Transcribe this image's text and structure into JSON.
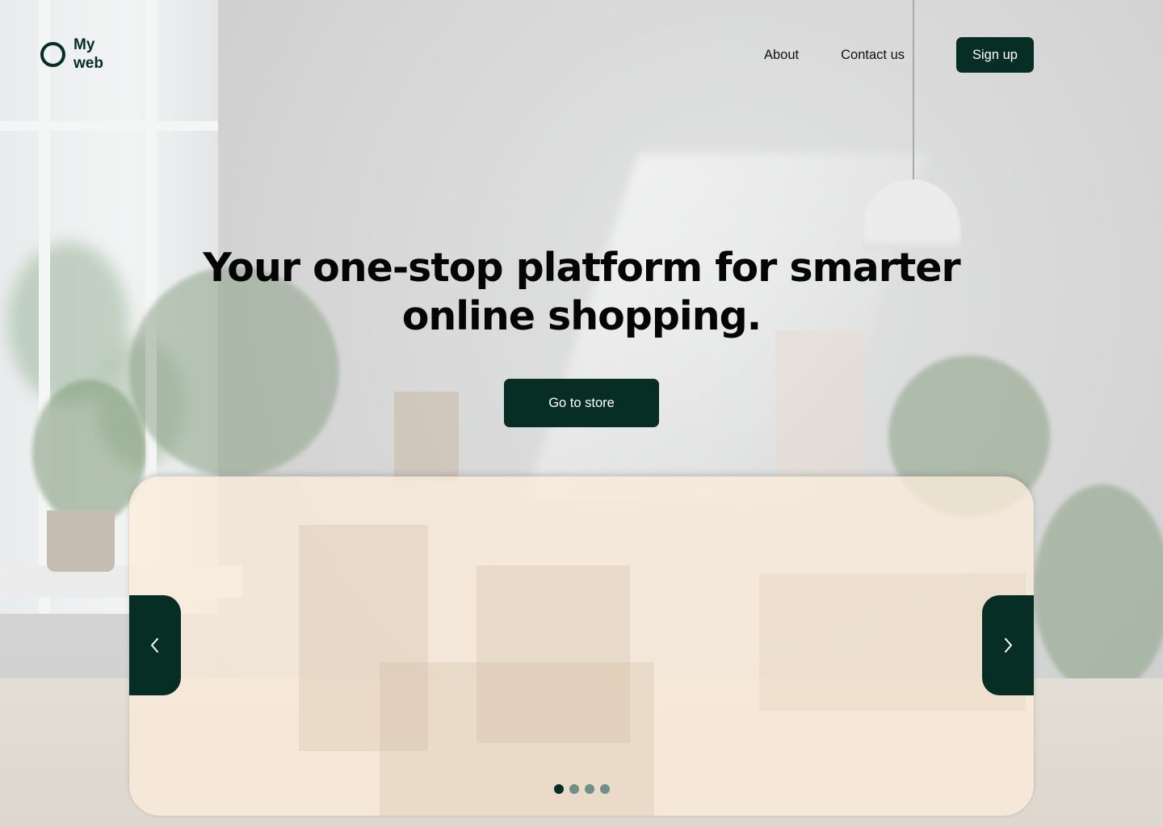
{
  "brand": {
    "name": "My web",
    "color": "#062e24"
  },
  "nav": {
    "items": [
      {
        "label": "About"
      },
      {
        "label": "Contact us"
      }
    ],
    "signup_label": "Sign up"
  },
  "hero": {
    "headline": "Your one-stop platform for smarter online shopping.",
    "cta_label": "Go to store"
  },
  "carousel": {
    "prev_icon": "chevron-left-icon",
    "next_icon": "chevron-right-icon",
    "slide_count": 4,
    "active_index": 0,
    "background": "#fbecda"
  },
  "colors": {
    "accent": "#062e24",
    "dot_inactive": "#6f8f88"
  }
}
